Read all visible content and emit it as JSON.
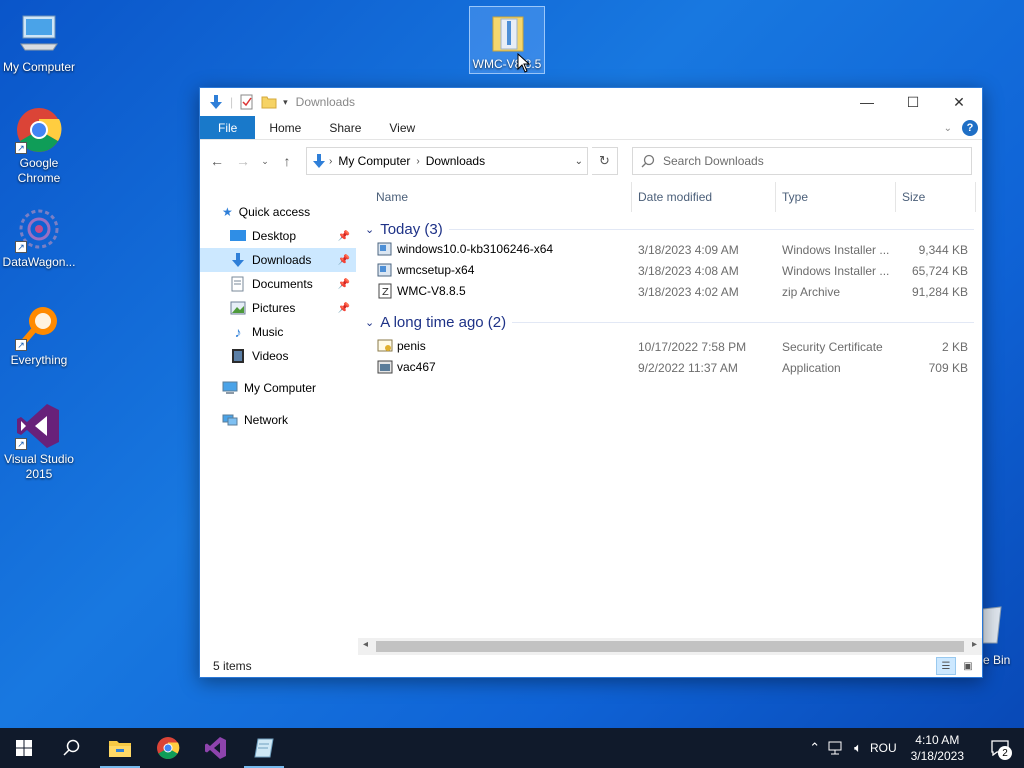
{
  "desktop": {
    "icons": [
      {
        "label": "My Computer",
        "icon": "computer-icon"
      },
      {
        "label": "Google Chrome",
        "icon": "chrome-icon"
      },
      {
        "label": "DataWagon...",
        "icon": "datawagon-icon"
      },
      {
        "label": "Everything",
        "icon": "everything-search-icon"
      },
      {
        "label": "Visual Studio 2015",
        "icon": "visual-studio-icon"
      },
      {
        "label": "WMC-V8.8.5",
        "icon": "zip-folder-icon"
      }
    ],
    "recycle_bin_partial_label": "e Bin"
  },
  "window": {
    "title": "Downloads",
    "controls": {
      "minimize": "—",
      "maximize": "☐",
      "close": "✕"
    },
    "ribbon_tabs": [
      "File",
      "Home",
      "Share",
      "View"
    ],
    "help_label": "?",
    "address": {
      "crumbs": [
        "My Computer",
        "Downloads"
      ]
    },
    "search_placeholder": "Search Downloads",
    "nav": {
      "quick_access": "Quick access",
      "items": [
        "Desktop",
        "Downloads",
        "Documents",
        "Pictures",
        "Music",
        "Videos"
      ],
      "my_computer": "My Computer",
      "network": "Network"
    },
    "columns": [
      "Name",
      "Date modified",
      "Type",
      "Size"
    ],
    "groups": [
      {
        "title": "Today (3)",
        "files": [
          {
            "name": "windows10.0-kb3106246-x64",
            "date": "3/18/2023 4:09 AM",
            "type": "Windows Installer ...",
            "size": "9,344 KB"
          },
          {
            "name": "wmcsetup-x64",
            "date": "3/18/2023 4:08 AM",
            "type": "Windows Installer ...",
            "size": "65,724 KB"
          },
          {
            "name": "WMC-V8.8.5",
            "date": "3/18/2023 4:02 AM",
            "type": "zip Archive",
            "size": "91,284 KB"
          }
        ]
      },
      {
        "title": "A long time ago (2)",
        "files": [
          {
            "name": "penis",
            "date": "10/17/2022 7:58 PM",
            "type": "Security Certificate",
            "size": "2 KB"
          },
          {
            "name": "vac467",
            "date": "9/2/2022 11:37 AM",
            "type": "Application",
            "size": "709 KB"
          }
        ]
      }
    ],
    "status": "5 items"
  },
  "taskbar": {
    "language": "ROU",
    "time": "4:10 AM",
    "date": "3/18/2023",
    "notifications": "2"
  },
  "colors": {
    "accent": "#1979ca",
    "selection": "#cce8ff",
    "group_header": "#1e3287"
  }
}
